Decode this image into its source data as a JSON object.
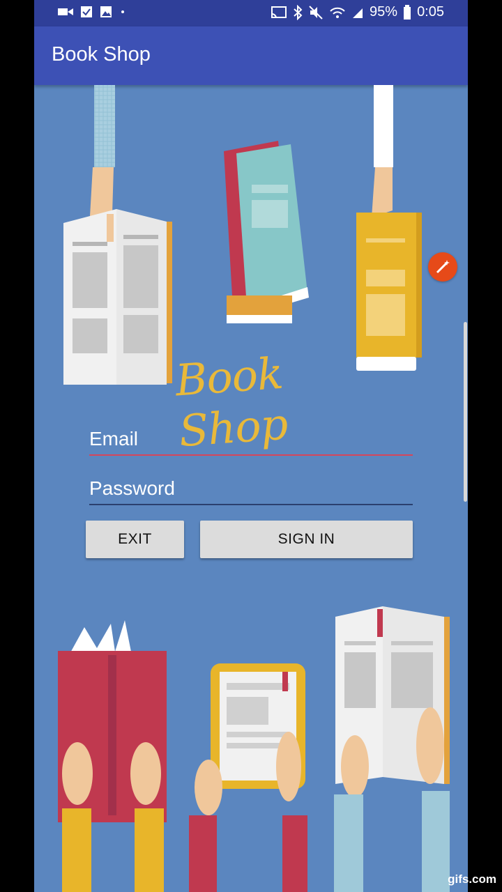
{
  "status_bar": {
    "battery_percent": "95%",
    "time": "0:05",
    "icons": [
      "video-icon",
      "check-icon",
      "image-icon",
      "dot-icon",
      "cast-icon",
      "bluetooth-icon",
      "mute-icon",
      "wifi-icon",
      "signal-icon",
      "battery-icon"
    ]
  },
  "app_bar": {
    "title": "Book Shop"
  },
  "illustration": {
    "logo_text": "Book Shop"
  },
  "form": {
    "email_placeholder": "Email",
    "password_placeholder": "Password",
    "email_underline_color": "#d6455a",
    "password_underline_color": "#2b3f6e"
  },
  "buttons": {
    "exit": "EXIT",
    "sign_in": "SIGN IN"
  },
  "watermark": "gifs.com",
  "colors": {
    "status_bar": "#2f3f99",
    "app_bar": "#3d51b5",
    "background": "#5b86bf",
    "fab": "#e64a19"
  }
}
